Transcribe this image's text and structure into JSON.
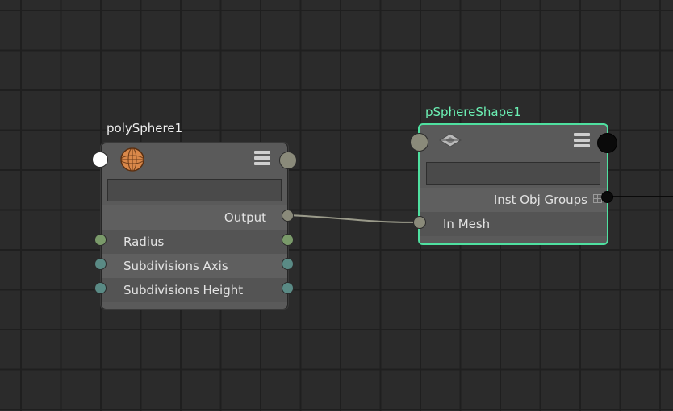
{
  "nodes": {
    "poly_sphere": {
      "title": "polySphere1",
      "icon": "sphere-icon",
      "attributes": [
        {
          "label": "Output"
        },
        {
          "label": "Radius"
        },
        {
          "label": "Subdivisions Axis"
        },
        {
          "label": "Subdivisions Height"
        }
      ]
    },
    "sphere_shape": {
      "title": "pSphereShape1",
      "icon": "diamond-mesh-icon",
      "attributes": [
        {
          "label": "Inst Obj Groups"
        },
        {
          "label": "In Mesh"
        }
      ]
    }
  },
  "connections": [
    {
      "from": "polySphere1.Output",
      "to": "pSphereShape1.In Mesh"
    }
  ],
  "colors": {
    "selection": "#4fe0a0",
    "selected_title": "#6cf0b4",
    "port_green": "#7a9a6a",
    "port_teal": "#5a8a85",
    "port_grey": "#8a8a7a"
  }
}
